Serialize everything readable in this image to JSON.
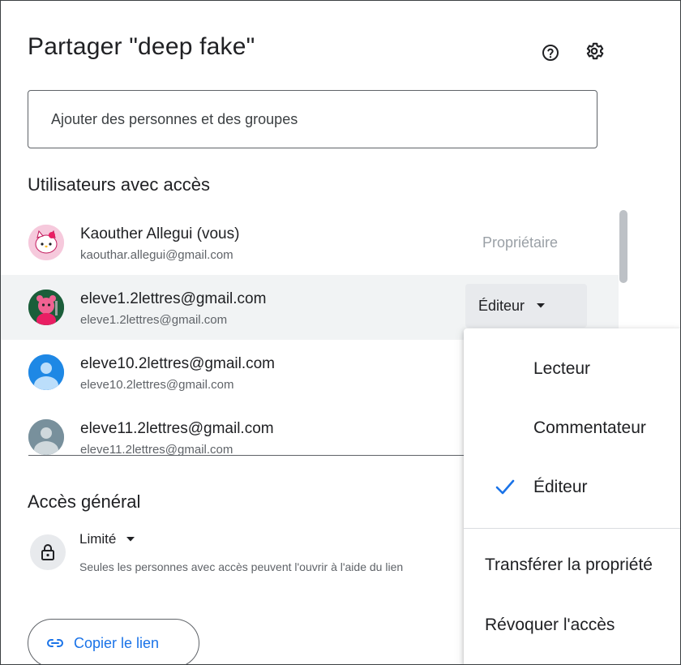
{
  "dialog": {
    "title": "Partager \"deep fake\"",
    "help_icon": "help-circle-icon",
    "settings_icon": "gear-icon"
  },
  "share_input": {
    "placeholder": "Ajouter des personnes et des groupes",
    "value": ""
  },
  "users_section": {
    "title": "Utilisateurs avec accès",
    "users": [
      {
        "name": "Kaouther Allegui (vous)",
        "email": "kaouthar.allegui@gmail.com",
        "role": "Propriétaire",
        "avatar": "hello-kitty-avatar"
      },
      {
        "name": "eleve1.2lettres@gmail.com",
        "email": "eleve1.2lettres@gmail.com",
        "role": "Éditeur",
        "avatar": "pink-character-avatar"
      },
      {
        "name": "eleve10.2lettres@gmail.com",
        "email": "eleve10.2lettres@gmail.com",
        "role": "",
        "avatar": "default-person-avatar-blue"
      },
      {
        "name": "eleve11.2lettres@gmail.com",
        "email": "eleve11.2lettres@gmail.com",
        "role": "",
        "avatar": "default-person-avatar-gray"
      }
    ]
  },
  "general_access": {
    "title": "Accès général",
    "level": "Limité",
    "description": "Seules les personnes avec accès peuvent l'ouvrir à l'aide du lien",
    "icon": "lock-icon"
  },
  "copy_link": {
    "label": "Copier le lien",
    "icon": "link-icon"
  },
  "role_menu": {
    "items": [
      {
        "label": "Lecteur",
        "selected": false
      },
      {
        "label": "Commentateur",
        "selected": false
      },
      {
        "label": "Éditeur",
        "selected": true
      }
    ],
    "actions": [
      {
        "label": "Transférer la propriété"
      },
      {
        "label": "Révoquer l'accès"
      }
    ]
  },
  "colors": {
    "accent": "#1a73e8",
    "hover_row": "#f1f3f4",
    "muted_text": "#5f6368",
    "disabled_text": "#9aa0a6"
  }
}
